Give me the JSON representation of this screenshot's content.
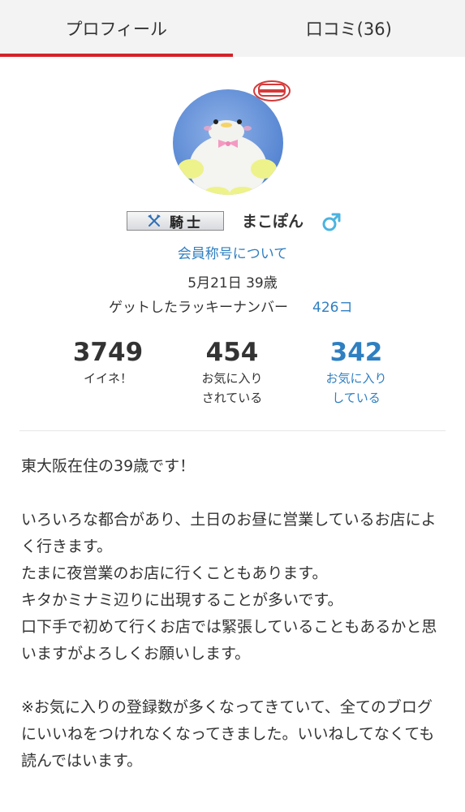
{
  "tabs": [
    {
      "label": "プロフィール",
      "active": true
    },
    {
      "label": "口コミ(36)",
      "active": false
    }
  ],
  "profile": {
    "rank_title": "騎士",
    "username": "まこぽん",
    "gender_symbol": "♂",
    "member_title_link": "会員称号について",
    "birth_age": "5月21日 39歳",
    "lucky_label": "ゲットしたラッキーナンバー",
    "lucky_count": "426コ"
  },
  "stats": [
    {
      "value": "3749",
      "label_line1": "イイネ！",
      "label_line2": ""
    },
    {
      "value": "454",
      "label_line1": "お気に入り",
      "label_line2": "されている"
    },
    {
      "value": "342",
      "label_line1": "お気に入り",
      "label_line2": "している"
    }
  ],
  "bio": "東大阪在住の39歳です！\n\nいろいろな都合があり、土日のお昼に営業しているお店によく行きます。\nたまに夜営業のお店に行くこともあります。\nキタかミナミ辺りに出現することが多いです。\n口下手で初めて行くお店では緊張していることもあるかと思いますがよろしくお願いします。\n\n※お気に入りの登録数が多くなってきていて、全てのブログにいいねをつけれなくなってきました。いいねしてなくても読んではいます。",
  "colors": {
    "active_tab_underline": "#d3222a",
    "link_blue": "#2f7fc1",
    "gender_icon": "#4bb3e0"
  },
  "icons": {
    "rank_badge_icon": "crossed-axes-icon",
    "gender_icon": "male-icon"
  }
}
